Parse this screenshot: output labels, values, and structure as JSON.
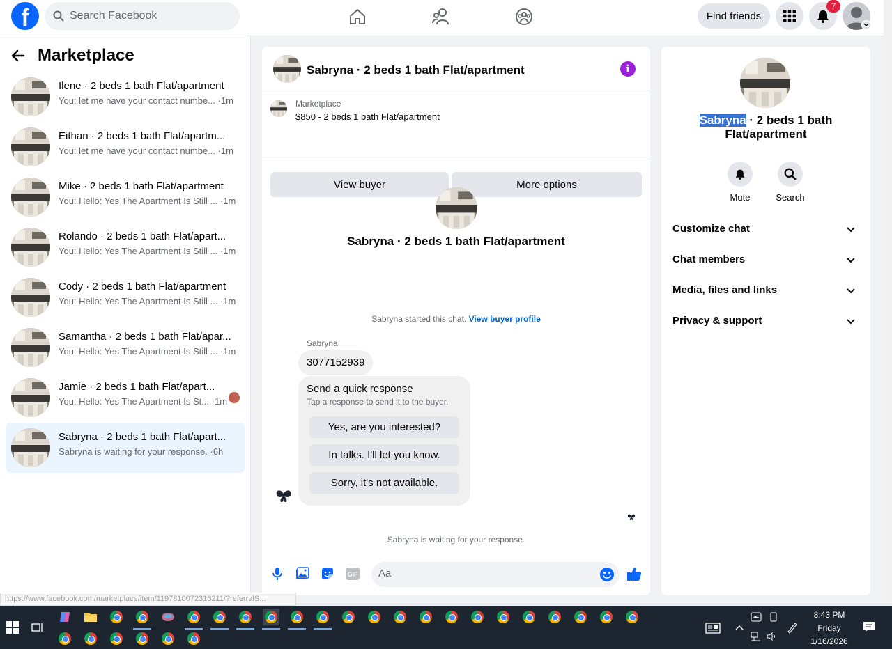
{
  "topnav": {
    "search_placeholder": "Search Facebook",
    "find_friends_label": "Find friends",
    "notification_count": "7"
  },
  "left": {
    "title": "Marketplace",
    "conversations": [
      {
        "name": "Ilene · 2 beds 1 bath Flat/apartment",
        "preview": "You: let me have your contact numbe... ·1m"
      },
      {
        "name": "Eithan · 2 beds 1 bath Flat/apartm...",
        "preview": "You: let me have your contact numbe... ·1m"
      },
      {
        "name": "Mike · 2 beds 1 bath Flat/apartment",
        "preview": "You: Hello: Yes The Apartment Is Still ... ·1m"
      },
      {
        "name": "Rolando · 2 beds 1 bath Flat/apart...",
        "preview": "You: Hello: Yes The Apartment Is Still ... ·1m"
      },
      {
        "name": "Cody · 2 beds 1 bath Flat/apartment",
        "preview": "You: Hello: Yes The Apartment Is Still ... ·1m"
      },
      {
        "name": "Samantha · 2 beds 1 bath Flat/apar...",
        "preview": "You: Hello: Yes The Apartment Is Still ... ·1m"
      },
      {
        "name": "Jamie · 2 beds 1 bath Flat/apart...",
        "preview": "You: Hello: Yes The Apartment Is St... ·1m"
      },
      {
        "name": "Sabryna · 2 beds 1 bath Flat/apart...",
        "preview": "Sabryna is waiting for your response. ·6h"
      }
    ]
  },
  "chat": {
    "title": "Sabryna · 2 beds 1 bath Flat/apartment",
    "listing_label": "Marketplace",
    "listing_price": "$850 - 2 beds 1 bath Flat/apartment",
    "view_buyer_label": "View buyer",
    "more_options_label": "More options",
    "intro_name": "Sabryna · 2 beds 1 bath Flat/apartment",
    "started_text": "Sabryna started this chat.",
    "view_buyer_profile": "View buyer profile",
    "sender_name": "Sabryna",
    "message": "3077152939",
    "quick_title": "Send a quick response",
    "quick_subtitle": "Tap a response to send it to the buyer.",
    "quick_responses": [
      "Yes, are you interested?",
      "In talks. I'll let you know.",
      "Sorry, it's not available."
    ],
    "waiting_text": "Sabryna is waiting for your response.",
    "composer_placeholder": "Aa"
  },
  "details": {
    "name_highlight": "Sabryna",
    "name_rest": " · 2 beds 1 bath Flat/apartment",
    "mute_label": "Mute",
    "search_label": "Search",
    "sections": [
      "Customize chat",
      "Chat members",
      "Media, files and links",
      "Privacy & support"
    ]
  },
  "status_url": "https://www.facebook.com/marketplace/item/1197810072316211/?referralS...",
  "taskbar": {
    "time": "8:43 PM",
    "day": "Friday",
    "date": "1/16/2026"
  },
  "colors": {
    "brand": "#0866ff",
    "active_row": "#ebf5ff",
    "info_icon": "#9b20d9",
    "link": "#0064d1"
  }
}
